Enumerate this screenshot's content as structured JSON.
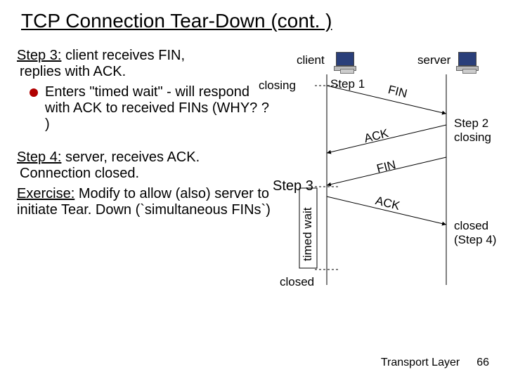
{
  "title": "TCP Connection Tear-Down (cont. )",
  "step3": {
    "label": "Step 3:",
    "text": "client receives FIN, replies with ACK.",
    "bullet": "Enters \"timed wait\" - will respond with ACK to received FINs (WHY? ? )"
  },
  "step4": {
    "label": "Step 4:",
    "text": "server, receives ACK. Connection closed."
  },
  "exercise": {
    "label": "Exercise:",
    "text": "Modify to allow (also) server to initiate Tear. Down (`simultaneous FINs`)"
  },
  "diagram": {
    "client": "client",
    "server": "server",
    "closing_left": "closing",
    "step1": "Step 1",
    "fin1": "FIN",
    "ack1": "ACK",
    "step2": "Step 2",
    "closing_right": "closing",
    "fin2": "FIN",
    "step3": "Step 3",
    "timed_wait": "timed wait",
    "ack2": "ACK",
    "closed_left": "closed",
    "closed_right": "closed",
    "step4_right": "(Step 4)"
  },
  "footer": {
    "section": "Transport Layer",
    "page": "66"
  }
}
